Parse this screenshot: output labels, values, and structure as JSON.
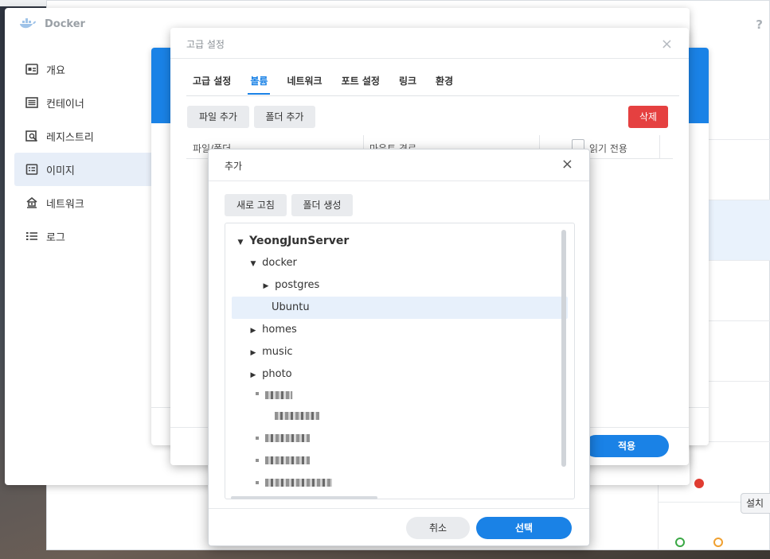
{
  "docker": {
    "title": "Docker",
    "help": "?",
    "sidebar": [
      {
        "label": "개요",
        "icon": "overview-icon"
      },
      {
        "label": "컨테이너",
        "icon": "container-icon"
      },
      {
        "label": "레지스트리",
        "icon": "registry-icon"
      },
      {
        "label": "이미지",
        "icon": "image-icon",
        "active": true
      },
      {
        "label": "네트워크",
        "icon": "network-icon"
      },
      {
        "label": "로그",
        "icon": "log-icon"
      }
    ]
  },
  "background": {
    "install_label": "설치"
  },
  "advanced_dialog": {
    "title": "고급 설정",
    "close": "×",
    "tabs": [
      {
        "label": "고급 설정",
        "active": false
      },
      {
        "label": "볼륨",
        "active": true
      },
      {
        "label": "네트워크",
        "active": false
      },
      {
        "label": "포트 설정",
        "active": false
      },
      {
        "label": "링크",
        "active": false
      },
      {
        "label": "환경",
        "active": false
      }
    ],
    "add_file_label": "파일 추가",
    "add_folder_label": "폴더 추가",
    "delete_label": "삭제",
    "columns": {
      "file_folder": "파일/폴더",
      "mount_path": "마운트 경로",
      "read_only": "읽기 전용"
    },
    "apply_label": "적용"
  },
  "add_dialog": {
    "title": "추가",
    "close": "×",
    "refresh_label": "새로 고침",
    "create_folder_label": "폴더 생성",
    "tree": [
      {
        "label": "YeongJunServer",
        "level": 0,
        "expanded": true,
        "root": true
      },
      {
        "label": "docker",
        "level": 1,
        "expanded": true
      },
      {
        "label": "postgres",
        "level": 2,
        "expanded": false
      },
      {
        "label": "Ubuntu",
        "level": 2,
        "leaf": true,
        "selected": true
      },
      {
        "label": "homes",
        "level": 1,
        "expanded": false
      },
      {
        "label": "music",
        "level": 1,
        "expanded": false
      },
      {
        "label": "photo",
        "level": 1,
        "expanded": false
      }
    ],
    "cancel_label": "취소",
    "select_label": "선택"
  },
  "colors": {
    "accent": "#1a82e6",
    "danger": "#e54040",
    "selected_row": "#e7f0fb"
  }
}
